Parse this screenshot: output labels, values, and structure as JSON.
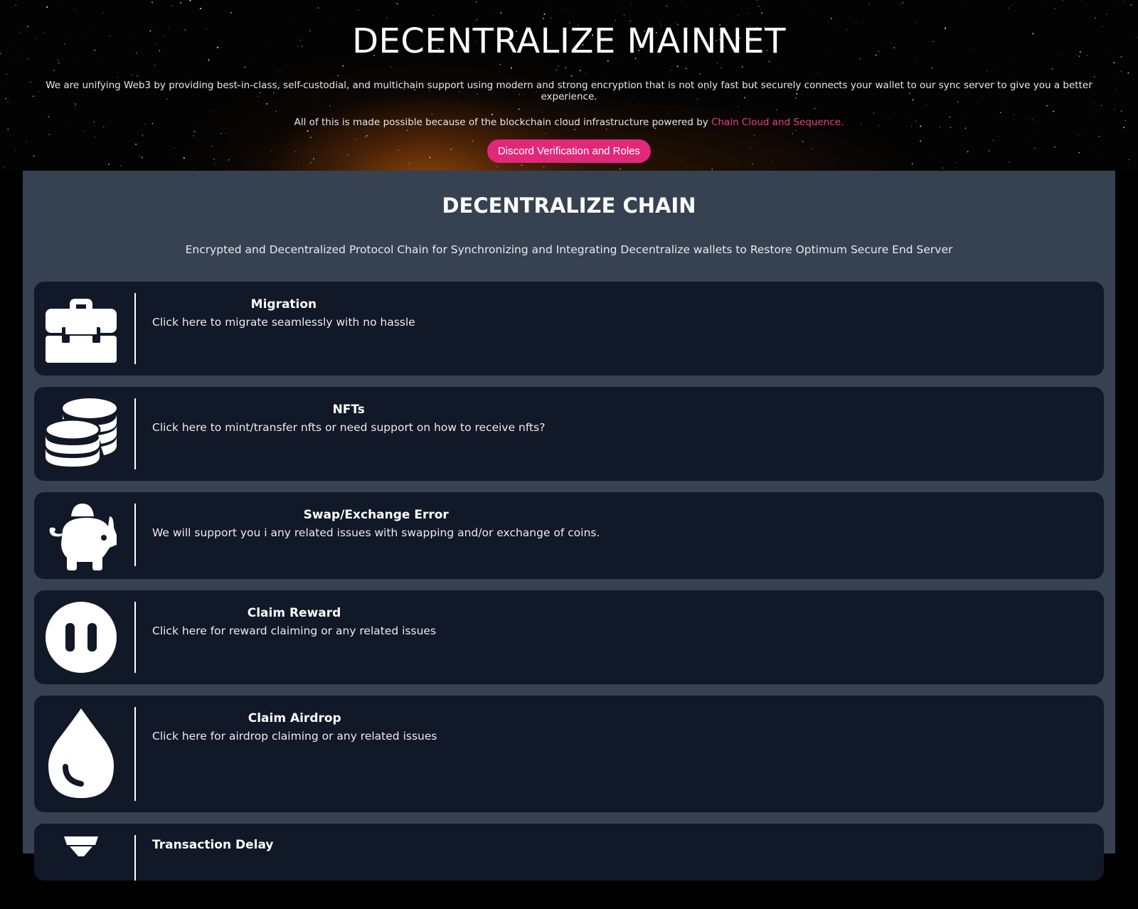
{
  "hero": {
    "title": "DECENTRALIZE MAINNET",
    "description": "We are unifying Web3 by providing best-in-class, self-custodial, and multichain support using modern and strong encryption that is not only fast but securely connects your wallet to our sync server to give you a better experience.",
    "powered_prefix": "All of this is made possible because of the blockchain cloud infrastructure powered by ",
    "powered_link": "Chain Cloud and Sequence.",
    "discord_button": "Discord Verification and Roles"
  },
  "main": {
    "title": "DECENTRALIZE CHAIN",
    "subtitle": "Encrypted and Decentralized Protocol Chain for Synchronizing and Integrating Decentralize wallets to Restore Optimum Secure End Server",
    "cards": [
      {
        "title": "Migration",
        "description": "Click here to migrate seamlessly with no hassle",
        "icon": "toolbox-icon"
      },
      {
        "title": "NFTs",
        "description": "Click here to mint/transfer nfts or need support on how to receive nfts?",
        "icon": "coins-icon"
      },
      {
        "title": "Swap/Exchange Error",
        "description": "We will support you i any related issues with swapping and/or exchange of coins.",
        "icon": "piggy-bank-icon"
      },
      {
        "title": "Claim Reward",
        "description": "Click here for reward claiming or any related issues",
        "icon": "pause-circle-icon"
      },
      {
        "title": "Claim Airdrop",
        "description": "Click here for airdrop claiming or any related issues",
        "icon": "droplet-icon"
      },
      {
        "title": "Transaction Delay",
        "description": "",
        "icon": "hourglass-icon"
      }
    ]
  },
  "colors": {
    "accent": "#e0297a",
    "link": "#e83e8c",
    "panel": "#364152",
    "card": "#111827"
  }
}
